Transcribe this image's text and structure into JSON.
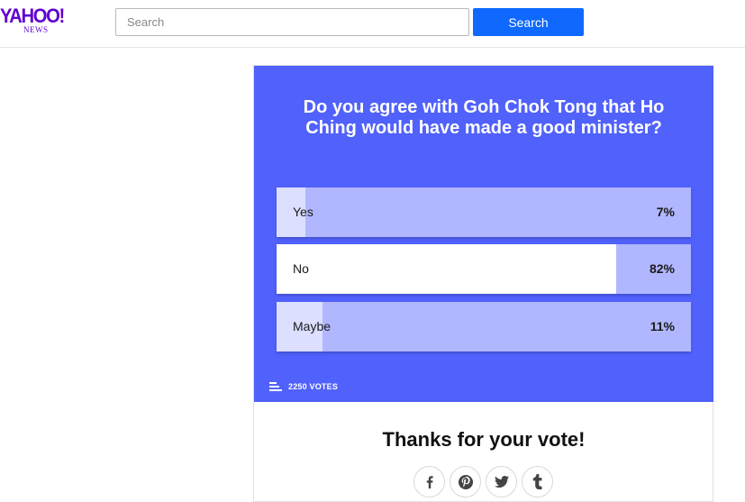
{
  "header": {
    "logo_main": "YAHOO!",
    "logo_sub": "NEWS",
    "search_placeholder": "Search",
    "search_button_label": "Search"
  },
  "poll": {
    "question": "Do you agree with Goh Chok Tong that Ho Ching would have made a good minister?",
    "options": [
      {
        "label": "Yes",
        "percent_label": "7%",
        "share": 0.07,
        "selected": false
      },
      {
        "label": "No",
        "percent_label": "82%",
        "share": 0.82,
        "selected": true
      },
      {
        "label": "Maybe",
        "percent_label": "11%",
        "share": 0.11,
        "selected": false
      }
    ],
    "votes": "2250 VOTES",
    "thanks": "Thanks for your vote!",
    "share_icons": [
      "facebook-icon",
      "pinterest-icon",
      "twitter-icon",
      "tumblr-icon"
    ]
  },
  "colors": {
    "brand": "#5f01d1",
    "search_button": "#0f69ff",
    "poll_background": "#5061fc",
    "option_remainder": "#b0b7ff",
    "option_fill": "#dcdfff",
    "option_selected_fill": "#ffffff"
  }
}
